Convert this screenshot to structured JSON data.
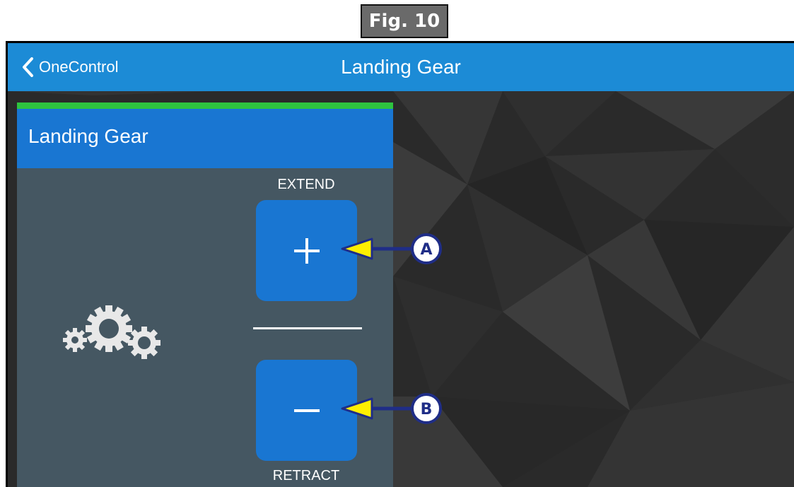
{
  "figure_label": "Fig. 10",
  "navbar": {
    "back_label": "OneControl",
    "title": "Landing Gear",
    "color": "#1c8bd6"
  },
  "panel": {
    "title": "Landing Gear",
    "accent_color": "#2ec33f",
    "header_color": "#1976d2",
    "body_color": "#455762",
    "icon": "gears-icon",
    "extend_label": "EXTEND",
    "retract_label": "RETRACT",
    "extend_icon": "plus-icon",
    "retract_icon": "minus-icon"
  },
  "callouts": {
    "a": "A",
    "b": "B",
    "arrow_color": "#ffef00",
    "line_color": "#1f2d87"
  }
}
